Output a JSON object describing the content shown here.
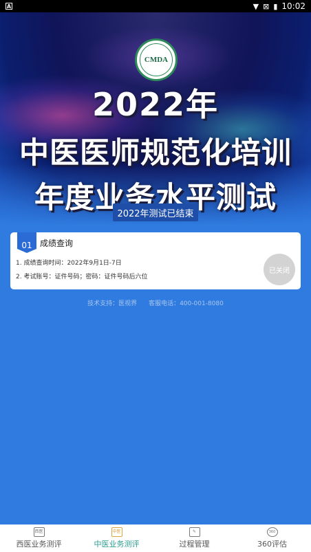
{
  "status_bar": {
    "left_badge": "A",
    "time": "10:02"
  },
  "hero": {
    "logo_text": "CMDA",
    "year_title": "2022年",
    "title_line1": "中医医师规范化培训",
    "title_line2": "年度业务水平测试",
    "ended_badge": "2022年测试已结束"
  },
  "card": {
    "number": "01",
    "title": "成绩查询",
    "line1": "1. 成绩查询时间：2022年9月1日-7日",
    "line2": "2. 考试账号：证件号码；密码：证件号码后六位",
    "status_button": "已关闭"
  },
  "footer": {
    "support": "技术支持：医视界",
    "hotline": "客服电话：400-001-8080"
  },
  "bottom_nav": [
    {
      "label": "西医业务测评",
      "icon_text": "西医",
      "active": false
    },
    {
      "label": "中医业务测评",
      "icon_text": "中医",
      "active": true
    },
    {
      "label": "过程管理",
      "icon_text": "",
      "active": false
    },
    {
      "label": "360评估",
      "icon_text": "360",
      "active": false
    }
  ],
  "colors": {
    "background": "#2f7be0",
    "accent_active": "#2a9d8f",
    "badge_bg": "#1e4ea8"
  }
}
